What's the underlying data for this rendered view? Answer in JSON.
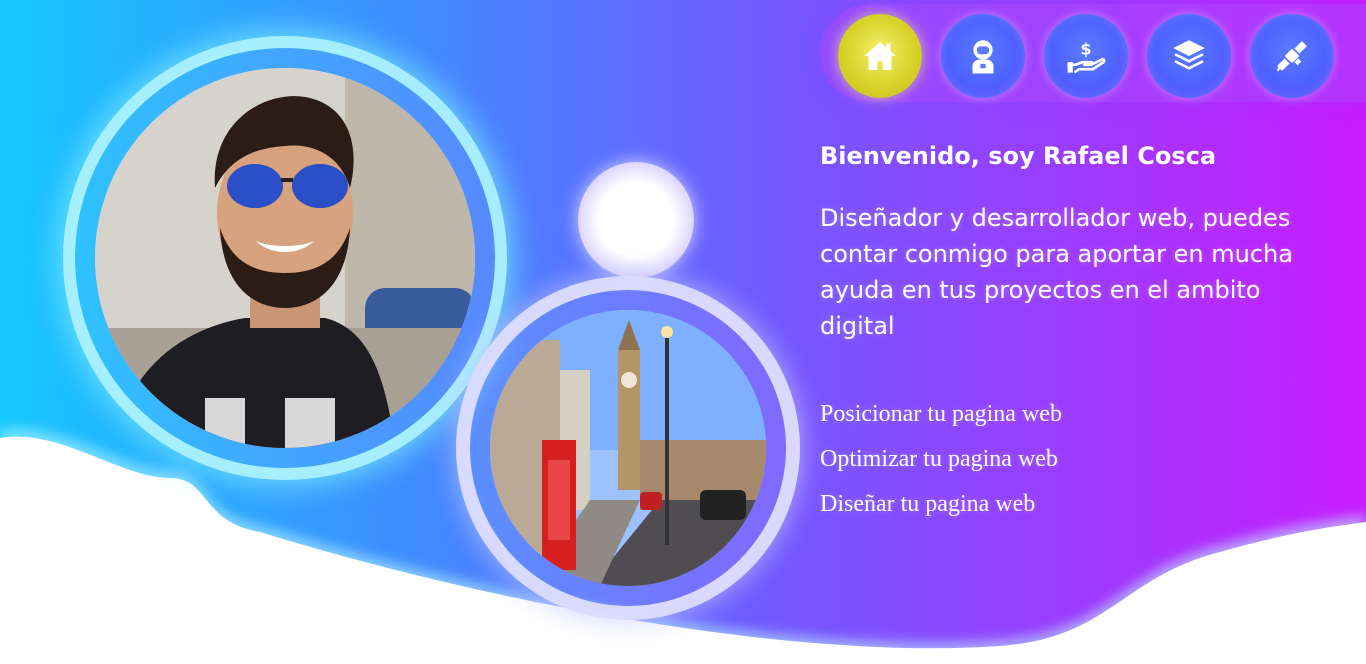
{
  "nav": {
    "items": [
      {
        "icon": "home-icon",
        "active": true
      },
      {
        "icon": "astronaut-icon",
        "active": false
      },
      {
        "icon": "money-hand-icon",
        "active": false
      },
      {
        "icon": "layers-icon",
        "active": false
      },
      {
        "icon": "satellite-icon",
        "active": false
      }
    ],
    "accent": "#d8d22a"
  },
  "hero": {
    "greeting": "Bienvenido, soy Rafael Cosca",
    "description": "Diseñador y desarrollador web, puedes contar conmigo para aportar en mucha ayuda en tus proyectos en el ambito digital"
  },
  "services": [
    "Posicionar tu pagina web",
    "Optimizar tu pagina web",
    "Diseñar tu pagina web"
  ],
  "colors": {
    "gradient_start": "#16c8ff",
    "gradient_end": "#c81bff",
    "text": "#ffffff"
  }
}
